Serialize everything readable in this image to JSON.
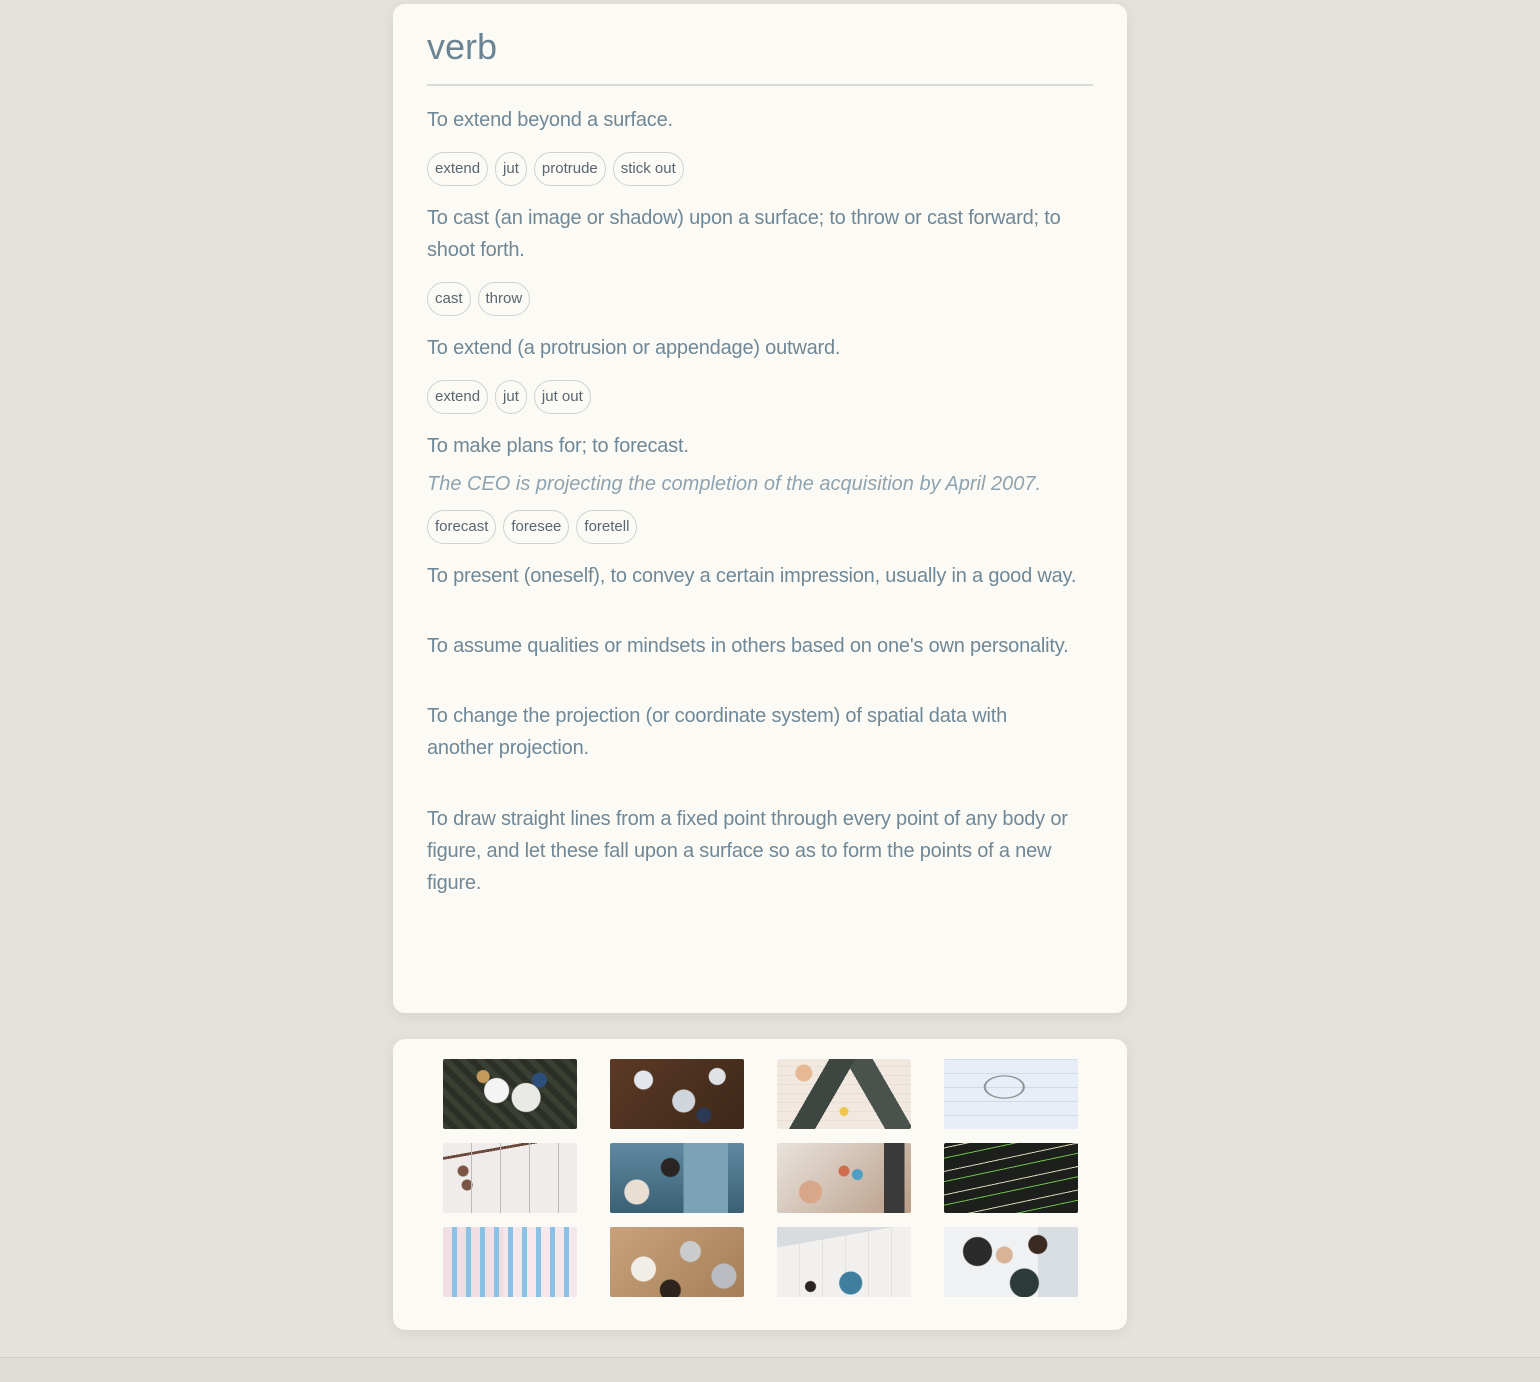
{
  "entry": {
    "part_of_speech": "verb",
    "definitions": [
      {
        "text": "To extend beyond a surface.",
        "example": "",
        "synonyms": [
          "extend",
          "jut",
          "protrude",
          "stick out"
        ]
      },
      {
        "text": "To cast (an image or shadow) upon a surface; to throw or cast forward; to shoot forth.",
        "example": "",
        "synonyms": [
          "cast",
          "throw"
        ]
      },
      {
        "text": "To extend (a protrusion or appendage) outward.",
        "example": "",
        "synonyms": [
          "extend",
          "jut",
          "jut out"
        ]
      },
      {
        "text": "To make plans for; to forecast.",
        "example": "The CEO is projecting the completion of the acquisition by April 2007.",
        "synonyms": [
          "forecast",
          "foresee",
          "foretell"
        ]
      },
      {
        "text": "To present (oneself), to convey a certain impression, usually in a good way.",
        "example": "",
        "synonyms": []
      },
      {
        "text": "To assume qualities or mindsets in others based on one's own personality.",
        "example": "",
        "synonyms": []
      },
      {
        "text": "To change the projection (or coordinate system) of spatial data with another projection.",
        "example": "",
        "synonyms": []
      },
      {
        "text": "To draw straight lines from a fixed point through every point of any body or figure, and let these fall upon a surface so as to form the points of a new figure.",
        "example": "",
        "synonyms": []
      }
    ]
  },
  "images": [
    {
      "subject": "meeting-table-photo"
    },
    {
      "subject": "team-laptops-photo"
    },
    {
      "subject": "keyboards-desk-photo"
    },
    {
      "subject": "sketch-drawing-photo"
    },
    {
      "subject": "planner-notebook-photo"
    },
    {
      "subject": "woman-laptop-photo"
    },
    {
      "subject": "charts-phone-photo"
    },
    {
      "subject": "code-screen-photo"
    },
    {
      "subject": "sticky-notes-board-photo"
    },
    {
      "subject": "desk-overhead-photo"
    },
    {
      "subject": "coffee-laptop-photo"
    },
    {
      "subject": "team-computer-photo"
    }
  ],
  "colors": {
    "background": "#e5e2dc",
    "card": "#fcfaf4",
    "text": "#6f8898",
    "example_text": "#8ea3b0",
    "chip_text": "#596670",
    "chip_border": "#cfd2d0"
  }
}
